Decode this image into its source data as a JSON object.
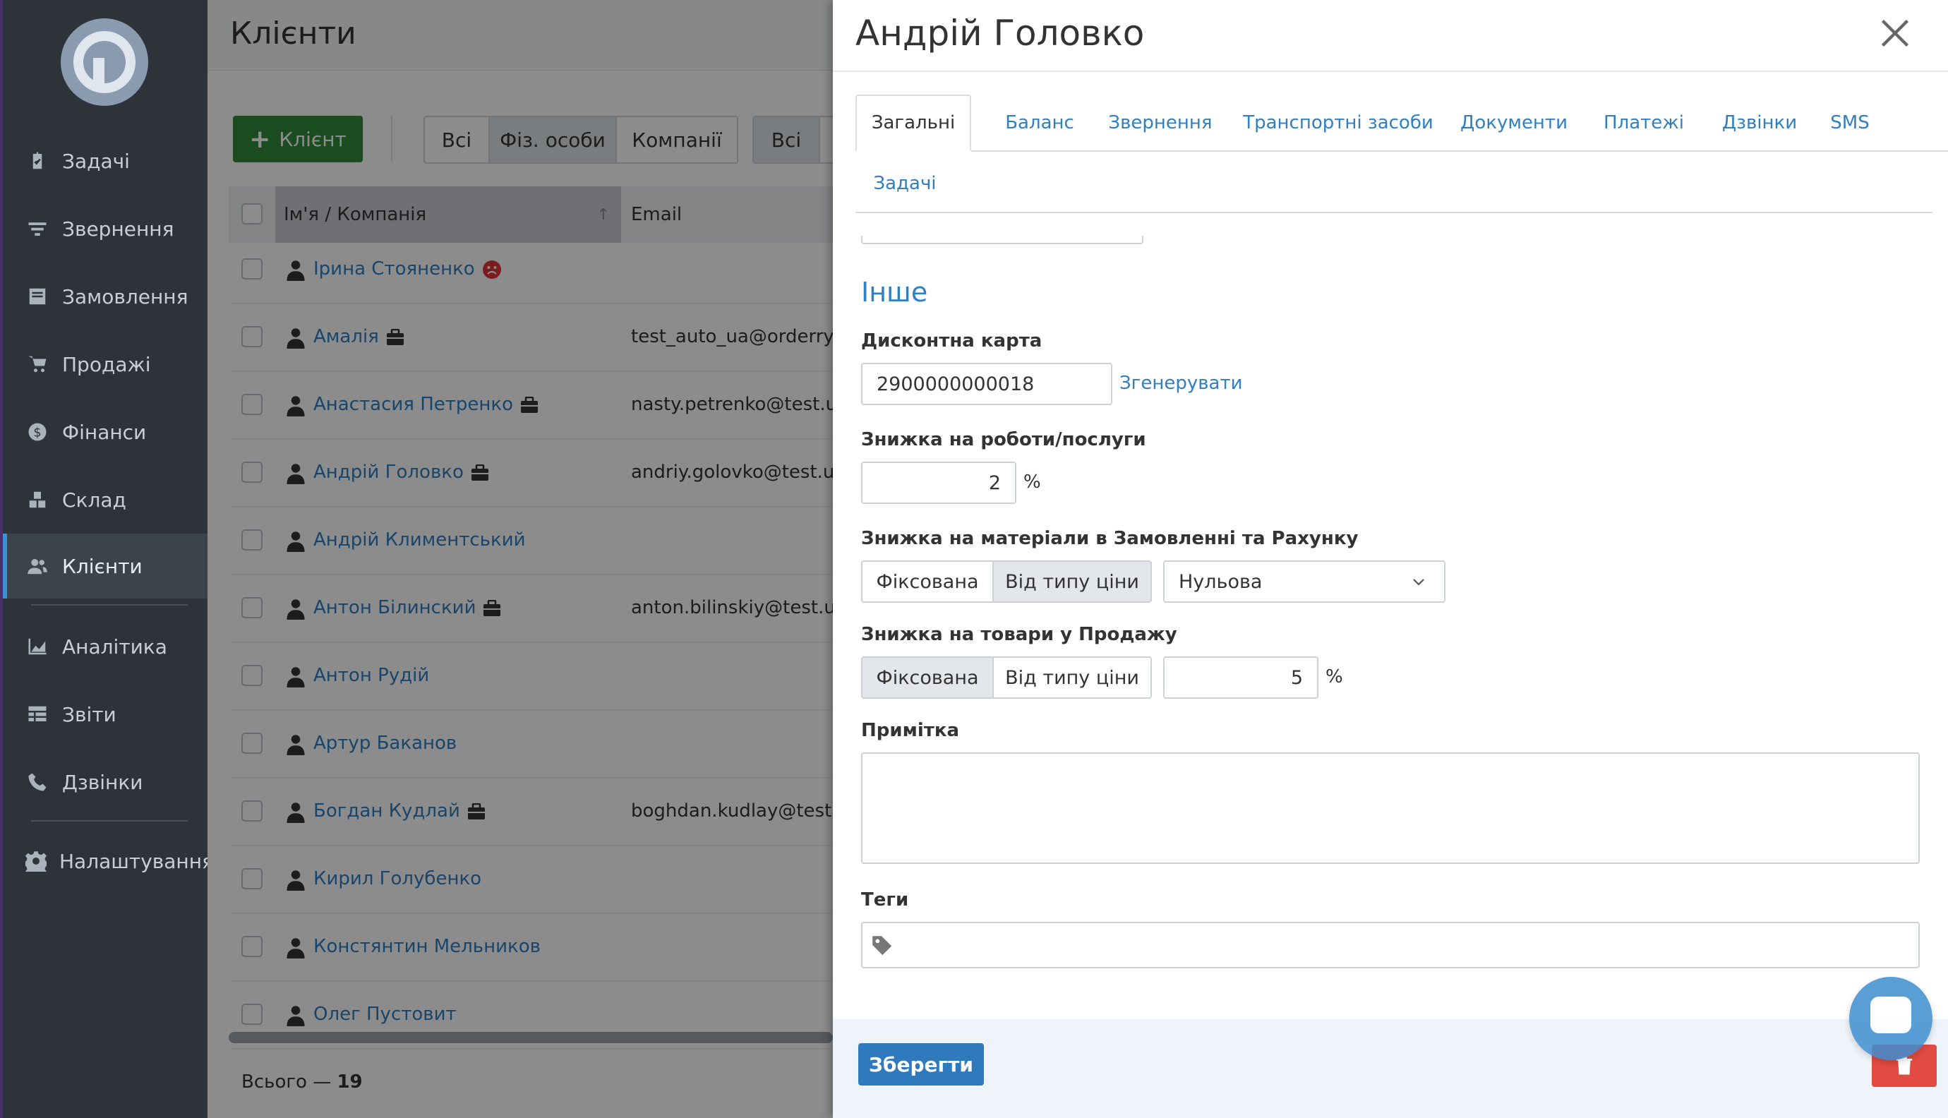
{
  "sidebar": {
    "items": [
      {
        "label": "Задачі",
        "icon": "clipboard-check-icon"
      },
      {
        "label": "Звернення",
        "icon": "filter-icon"
      },
      {
        "label": "Замовлення",
        "icon": "inbox-icon"
      },
      {
        "label": "Продажі",
        "icon": "cart-icon"
      },
      {
        "label": "Фінанси",
        "icon": "dollar-circle-icon"
      },
      {
        "label": "Склад",
        "icon": "boxes-icon"
      },
      {
        "label": "Клієнти",
        "icon": "users-icon",
        "active": true
      },
      {
        "label": "Аналітика",
        "icon": "area-chart-icon"
      },
      {
        "label": "Звіти",
        "icon": "table-icon"
      },
      {
        "label": "Дзвінки",
        "icon": "phone-icon"
      },
      {
        "label": "Налаштування",
        "icon": "gear-icon"
      }
    ]
  },
  "list": {
    "title": "Клієнти",
    "add_label": "Клієнт",
    "filter_type": [
      "Всі",
      "Фіз. особи",
      "Компанії"
    ],
    "filter_type_selected": "Фіз. особи",
    "filter2_first": "Всі",
    "columns": {
      "name": "Ім'я / Компанія",
      "email": "Email"
    },
    "rows": [
      {
        "name": "Ірина Стояненко",
        "email": "",
        "badge": "sad-face-icon"
      },
      {
        "name": "Амалія",
        "email": "test_auto_ua@orderry.c",
        "badge": "briefcase-icon"
      },
      {
        "name": "Анастасия Петренко",
        "email": "nasty.petrenko@test.ua",
        "badge": "briefcase-icon"
      },
      {
        "name": "Андрій Головко",
        "email": "andriy.golovko@test.ua",
        "badge": "briefcase-icon"
      },
      {
        "name": "Андрій Климентський",
        "email": "",
        "badge": ""
      },
      {
        "name": "Антон Білинский",
        "email": "anton.bilinskiy@test.ua",
        "badge": "briefcase-icon"
      },
      {
        "name": "Антон Рудій",
        "email": "",
        "badge": ""
      },
      {
        "name": "Артур Баканов",
        "email": "",
        "badge": ""
      },
      {
        "name": "Богдан Кудлай",
        "email": "boghdan.kudlay@test.ua",
        "badge": "briefcase-icon"
      },
      {
        "name": "Кирил Голубенко",
        "email": "",
        "badge": ""
      },
      {
        "name": "Констянтин Мельников",
        "email": "",
        "badge": ""
      },
      {
        "name": "Олег Пустовит",
        "email": "",
        "badge": ""
      }
    ],
    "total_label": "Всього —",
    "total_count": "19"
  },
  "modal": {
    "title": "Андрій Головко",
    "tabs": [
      "Загальні",
      "Баланс",
      "Звернення",
      "Транспортні засоби",
      "Документи",
      "Платежі",
      "Дзвінки",
      "SMS",
      "Задачі"
    ],
    "active_tab": "Загальні",
    "section_title": "Інше",
    "discount_card": {
      "label": "Дисконтна карта",
      "value": "2900000000018",
      "generate_label": "Згенерувати"
    },
    "work_discount": {
      "label": "Знижка на роботи/послуги",
      "value": "2",
      "unit": "%"
    },
    "materials_discount": {
      "label": "Знижка на матеріали в Замовленні та Рахунку",
      "options": [
        "Фіксована",
        "Від типу ціни"
      ],
      "selected": "Від типу ціни",
      "price_type": "Нульова"
    },
    "goods_discount": {
      "label": "Знижка на товари у Продажу",
      "options": [
        "Фіксована",
        "Від типу ціни"
      ],
      "selected": "Фіксована",
      "value": "5",
      "unit": "%"
    },
    "note": {
      "label": "Примітка",
      "value": ""
    },
    "tags": {
      "label": "Теги"
    },
    "save_label": "Зберегти"
  },
  "colors": {
    "accent": "#2f7fc1",
    "sidebar_bg": "#2d3339",
    "add_button": "#2e8b3a",
    "save_button": "#2f79bd",
    "delete_button": "#e24b42"
  }
}
